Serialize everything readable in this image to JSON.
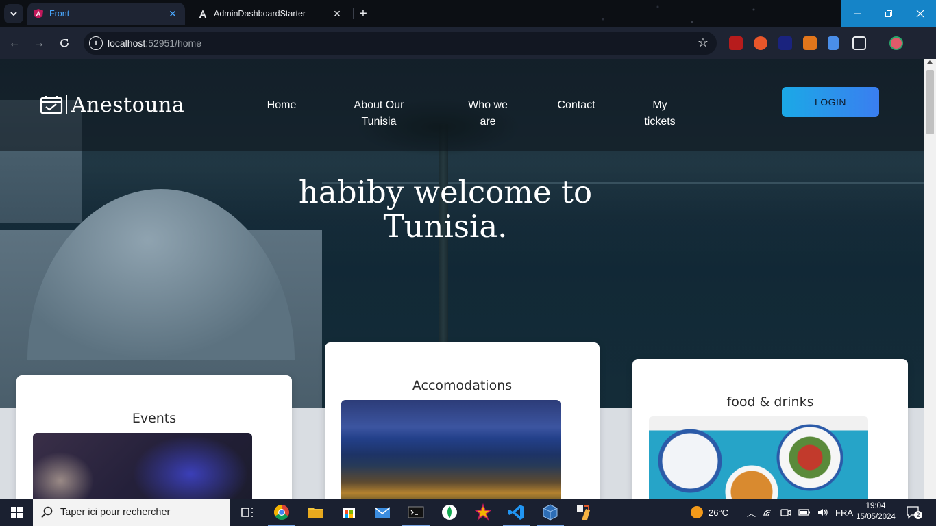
{
  "browser": {
    "tabs": [
      {
        "title": "Front",
        "active": true
      },
      {
        "title": "AdminDashboardStarter",
        "active": false
      }
    ],
    "url_host": "localhost",
    "url_rest": ":52951/home"
  },
  "site": {
    "logo_text": "Anestouna",
    "nav": {
      "home": "Home",
      "about_line1": "About Our",
      "about_line2": "Tunisia",
      "who_line1": "Who we",
      "who_line2": "are",
      "contact": "Contact",
      "tickets_line1": "My",
      "tickets_line2": "tickets"
    },
    "login_label": "LOGIN",
    "hero_line1": "habiby welcome to",
    "hero_line2": "Tunisia.",
    "cards": {
      "events": "Events",
      "accommodations": "Accomodations",
      "food": "food & drinks"
    }
  },
  "taskbar": {
    "search_placeholder": "Taper ici pour rechercher",
    "temperature": "26°C",
    "language": "FRA",
    "time": "19:04",
    "date": "15/05/2024",
    "notifications": "2"
  },
  "colors": {
    "login_gradient_start": "#1ba9e6",
    "login_gradient_end": "#3a7ef0",
    "active_tab_text": "#4aa8ff"
  }
}
